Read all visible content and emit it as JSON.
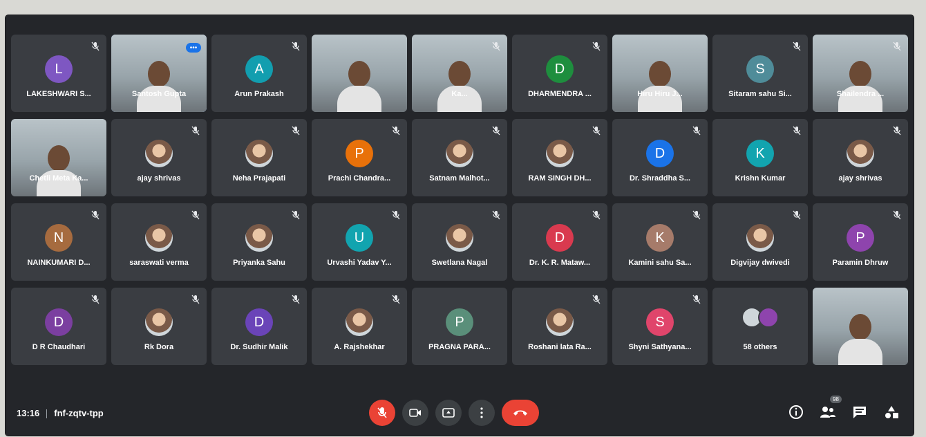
{
  "meeting": {
    "time": "13:16",
    "code": "fnf-zqtv-tpp"
  },
  "tiles": [
    {
      "name": "LAKESHWARI S...",
      "kind": "avatar",
      "initial": "L",
      "color": "#7e57c2",
      "muted": true
    },
    {
      "name": "Santosh Gupta",
      "kind": "cam",
      "muted": false,
      "active": true
    },
    {
      "name": "Arun Prakash",
      "kind": "avatar",
      "initial": "A",
      "color": "#129eaf",
      "muted": true
    },
    {
      "name": "",
      "kind": "cam",
      "muted": false
    },
    {
      "name": "Ka...",
      "kind": "cam",
      "muted": true
    },
    {
      "name": "DHARMENDRA ...",
      "kind": "avatar",
      "initial": "D",
      "color": "#1e8e3e",
      "muted": true
    },
    {
      "name": "Hiru Hiru J...",
      "kind": "cam",
      "muted": false
    },
    {
      "name": "Sitaram sahu Si...",
      "kind": "avatar",
      "initial": "S",
      "color": "#4f8c99",
      "muted": true
    },
    {
      "name": "Shailendra ...",
      "kind": "cam",
      "muted": true
    },
    {
      "name": "Chetli Meta Ka...",
      "kind": "cam",
      "muted": false
    },
    {
      "name": "ajay shrivas",
      "kind": "photo",
      "muted": true
    },
    {
      "name": "Neha Prajapati",
      "kind": "photo",
      "muted": true
    },
    {
      "name": "Prachi Chandra...",
      "kind": "avatar",
      "initial": "P",
      "color": "#e8710a",
      "muted": true
    },
    {
      "name": "Satnam Malhot...",
      "kind": "photo",
      "muted": true
    },
    {
      "name": "RAM SINGH DH...",
      "kind": "photo",
      "muted": true
    },
    {
      "name": "Dr. Shraddha S...",
      "kind": "avatar",
      "initial": "D",
      "color": "#1a73e8",
      "muted": true
    },
    {
      "name": "Krishn Kumar",
      "kind": "avatar",
      "initial": "K",
      "color": "#12a4af",
      "muted": true
    },
    {
      "name": "ajay shrivas",
      "kind": "photo",
      "muted": true
    },
    {
      "name": "NAINKUMARI D...",
      "kind": "avatar",
      "initial": "N",
      "color": "#a66b3f",
      "muted": true
    },
    {
      "name": "saraswati verma",
      "kind": "photo",
      "muted": true
    },
    {
      "name": "Priyanka Sahu",
      "kind": "photo",
      "muted": true
    },
    {
      "name": "Urvashi Yadav Y...",
      "kind": "avatar",
      "initial": "U",
      "color": "#12a4af",
      "muted": true
    },
    {
      "name": "Swetlana Nagal",
      "kind": "photo",
      "muted": true
    },
    {
      "name": "Dr. K. R. Mataw...",
      "kind": "avatar",
      "initial": "D",
      "color": "#d93a4f",
      "muted": true
    },
    {
      "name": "Kamini sahu Sa...",
      "kind": "avatar",
      "initial": "K",
      "color": "#a67b6a",
      "muted": true
    },
    {
      "name": "Digvijay dwivedi",
      "kind": "photo",
      "muted": true
    },
    {
      "name": "Paramin Dhruw",
      "kind": "avatar",
      "initial": "P",
      "color": "#8e44ad",
      "muted": true
    },
    {
      "name": "D R Chaudhari",
      "kind": "avatar",
      "initial": "D",
      "color": "#7b3fa0",
      "muted": true
    },
    {
      "name": "Rk Dora",
      "kind": "photo",
      "muted": true
    },
    {
      "name": "Dr. Sudhir Malik",
      "kind": "avatar",
      "initial": "D",
      "color": "#6a44b8",
      "muted": true
    },
    {
      "name": "A. Rajshekhar",
      "kind": "photo",
      "muted": true
    },
    {
      "name": "PRAGNA PARA...",
      "kind": "avatar",
      "initial": "P",
      "color": "#5a8f7a",
      "muted": false
    },
    {
      "name": "Roshani lata Ra...",
      "kind": "photo",
      "muted": true
    },
    {
      "name": "Shyni Sathyana...",
      "kind": "avatar",
      "initial": "S",
      "color": "#e0456b",
      "muted": true
    },
    {
      "name": "58 others",
      "kind": "others",
      "muted": false
    },
    {
      "name": "",
      "kind": "cam",
      "muted": false
    }
  ],
  "labels": {
    "others_dots": "•••",
    "participants_badge": "98"
  },
  "colors": {
    "accent": "#1a73e8",
    "danger": "#ea4335"
  },
  "icons": {
    "info": "info-icon",
    "people": "people-icon",
    "chat": "chat-icon",
    "activities": "activities-icon"
  }
}
